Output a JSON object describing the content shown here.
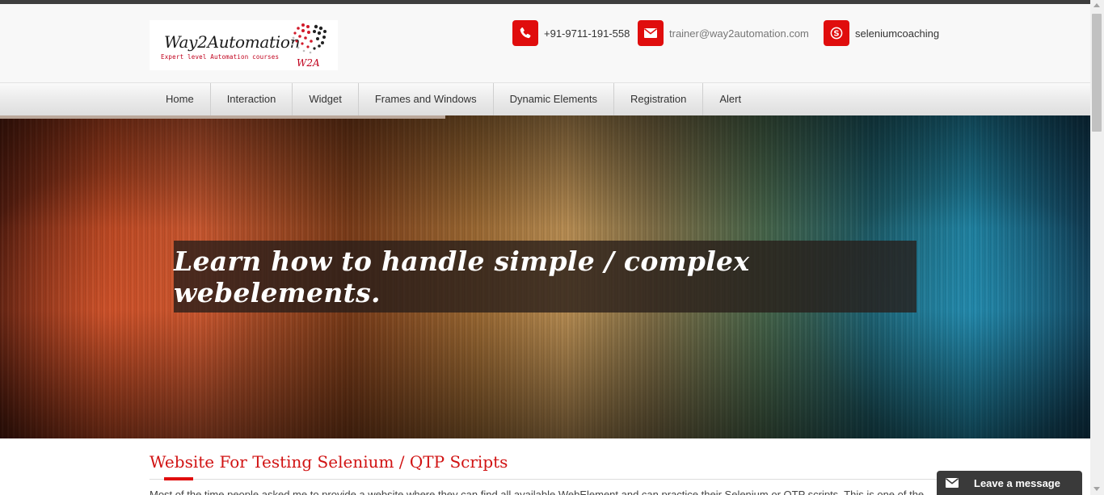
{
  "brand": {
    "logo_title": "Way2Automation",
    "logo_tagline": "Expert level Automation courses",
    "logo_mark_text": "W2A",
    "accent_color": "#e00d0d"
  },
  "contacts": [
    {
      "icon": "phone-icon",
      "text": "+91-9711-191-558"
    },
    {
      "icon": "envelope-icon",
      "text": "trainer@way2automation.com"
    },
    {
      "icon": "skype-icon",
      "text": "seleniumcoaching"
    }
  ],
  "nav": {
    "items": [
      {
        "label": "Home"
      },
      {
        "label": "Interaction"
      },
      {
        "label": "Widget"
      },
      {
        "label": "Frames and Windows"
      },
      {
        "label": "Dynamic Elements"
      },
      {
        "label": "Registration"
      },
      {
        "label": "Alert"
      }
    ]
  },
  "hero": {
    "caption": "Learn how to handle simple / complex webelements."
  },
  "main": {
    "section_title": "Website For Testing Selenium / QTP Scripts",
    "intro": "Most of the time people asked me to provide a website where they can find all available WebElement and can practice their Selenium or QTP scripts. This is one of the"
  },
  "chat_widget": {
    "icon": "envelope-icon",
    "label": "Leave a message"
  }
}
